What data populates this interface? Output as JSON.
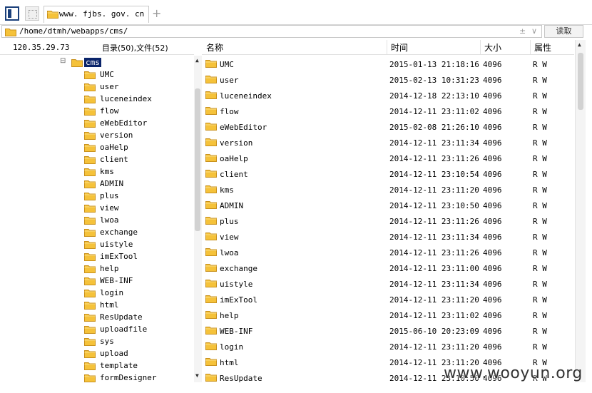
{
  "tab": {
    "title": "www. fjbs. gov. cn",
    "add_label": "+"
  },
  "address": {
    "path": "/home/dtmh/webapps/cms/",
    "plus_glyph": "±",
    "dropdown_glyph": "∨",
    "read_label": "读取"
  },
  "info": {
    "ip": "120.35.29.73",
    "counts": "目录(50),文件(52)"
  },
  "tree": {
    "expander": "⊟",
    "root": "cms",
    "children": [
      "UMC",
      "user",
      "luceneindex",
      "flow",
      "eWebEditor",
      "version",
      "oaHelp",
      "client",
      "kms",
      "ADMIN",
      "plus",
      "view",
      "lwoa",
      "exchange",
      "uistyle",
      "imExTool",
      "help",
      "WEB-INF",
      "login",
      "html",
      "ResUpdate",
      "uploadfile",
      "sys",
      "upload",
      "template",
      "formDesigner"
    ]
  },
  "table": {
    "headers": {
      "name": "名称",
      "time": "时间",
      "size": "大小",
      "attr": "属性"
    },
    "rows": [
      {
        "name": "UMC",
        "time": "2015-01-13 21:18:16",
        "size": "4096",
        "attr": "R W"
      },
      {
        "name": "user",
        "time": "2015-02-13 10:31:23",
        "size": "4096",
        "attr": "R W"
      },
      {
        "name": "luceneindex",
        "time": "2014-12-18 22:13:10",
        "size": "4096",
        "attr": "R W"
      },
      {
        "name": "flow",
        "time": "2014-12-11 23:11:02",
        "size": "4096",
        "attr": "R W"
      },
      {
        "name": "eWebEditor",
        "time": "2015-02-08 21:26:10",
        "size": "4096",
        "attr": "R W"
      },
      {
        "name": "version",
        "time": "2014-12-11 23:11:34",
        "size": "4096",
        "attr": "R W"
      },
      {
        "name": "oaHelp",
        "time": "2014-12-11 23:11:26",
        "size": "4096",
        "attr": "R W"
      },
      {
        "name": "client",
        "time": "2014-12-11 23:10:54",
        "size": "4096",
        "attr": "R W"
      },
      {
        "name": "kms",
        "time": "2014-12-11 23:11:20",
        "size": "4096",
        "attr": "R W"
      },
      {
        "name": "ADMIN",
        "time": "2014-12-11 23:10:50",
        "size": "4096",
        "attr": "R W"
      },
      {
        "name": "plus",
        "time": "2014-12-11 23:11:26",
        "size": "4096",
        "attr": "R W"
      },
      {
        "name": "view",
        "time": "2014-12-11 23:11:34",
        "size": "4096",
        "attr": "R W"
      },
      {
        "name": "lwoa",
        "time": "2014-12-11 23:11:26",
        "size": "4096",
        "attr": "R W"
      },
      {
        "name": "exchange",
        "time": "2014-12-11 23:11:00",
        "size": "4096",
        "attr": "R W"
      },
      {
        "name": "uistyle",
        "time": "2014-12-11 23:11:34",
        "size": "4096",
        "attr": "R W"
      },
      {
        "name": "imExTool",
        "time": "2014-12-11 23:11:20",
        "size": "4096",
        "attr": "R W"
      },
      {
        "name": "help",
        "time": "2014-12-11 23:11:02",
        "size": "4096",
        "attr": "R W"
      },
      {
        "name": "WEB-INF",
        "time": "2015-06-10 20:23:09",
        "size": "4096",
        "attr": "R W"
      },
      {
        "name": "login",
        "time": "2014-12-11 23:11:20",
        "size": "4096",
        "attr": "R W"
      },
      {
        "name": "html",
        "time": "2014-12-11 23:11:20",
        "size": "4096",
        "attr": "R W"
      },
      {
        "name": "ResUpdate",
        "time": "2014-12-11 23:10:50",
        "size": "4096",
        "attr": "R W"
      }
    ]
  },
  "watermark": "www.wooyun.org",
  "colors": {
    "folder": "#f5c23a",
    "folder_edge": "#c8901c",
    "selection": "#0a246a"
  }
}
